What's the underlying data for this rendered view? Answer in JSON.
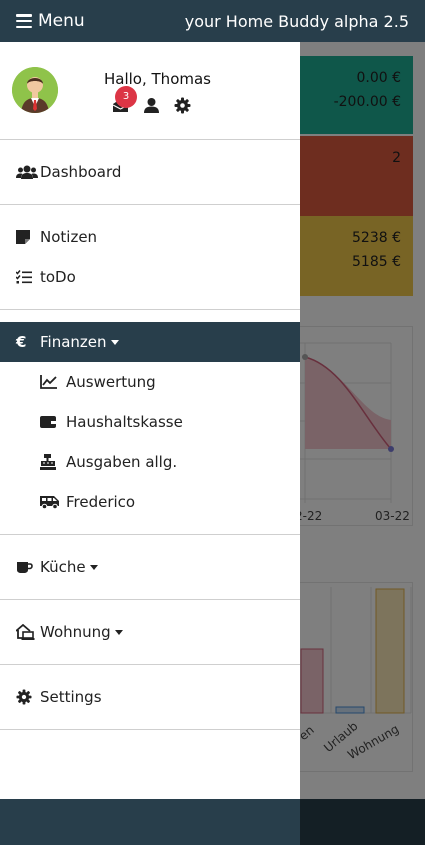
{
  "topbar": {
    "menu_label": "Menu",
    "app_title": "your Home Buddy alpha 2.5"
  },
  "user": {
    "greeting": "Hallo, Thomas",
    "message_count": "3"
  },
  "nav": {
    "dashboard": "Dashboard",
    "notizen": "Notizen",
    "todo": "toDo",
    "finanzen": "Finanzen",
    "finanzen_sub": {
      "auswertung": "Auswertung",
      "haushaltskasse": "Haushaltskasse",
      "ausgaben": "Ausgaben allg.",
      "frederico": "Frederico"
    },
    "kueche": "Küche",
    "wohnung": "Wohnung",
    "settings": "Settings"
  },
  "background": {
    "card_teal": {
      "line1": "0.00 €",
      "line2": "-200.00 €"
    },
    "card_red": {
      "line1": "2"
    },
    "card_yellow": {
      "line1": "5238 €",
      "line2": "5185 €"
    },
    "chart1_xticks": [
      "2-22",
      "03-22"
    ],
    "chart2_labels": [
      "en",
      "Urlaub",
      "Wohnung"
    ]
  },
  "colors": {
    "topbar": "#283e4b",
    "active_item": "#283e4b",
    "badge": "#dc3545",
    "card_teal": "#1fae95",
    "card_red": "#dd5a3f",
    "card_yellow": "#f1c84b"
  }
}
